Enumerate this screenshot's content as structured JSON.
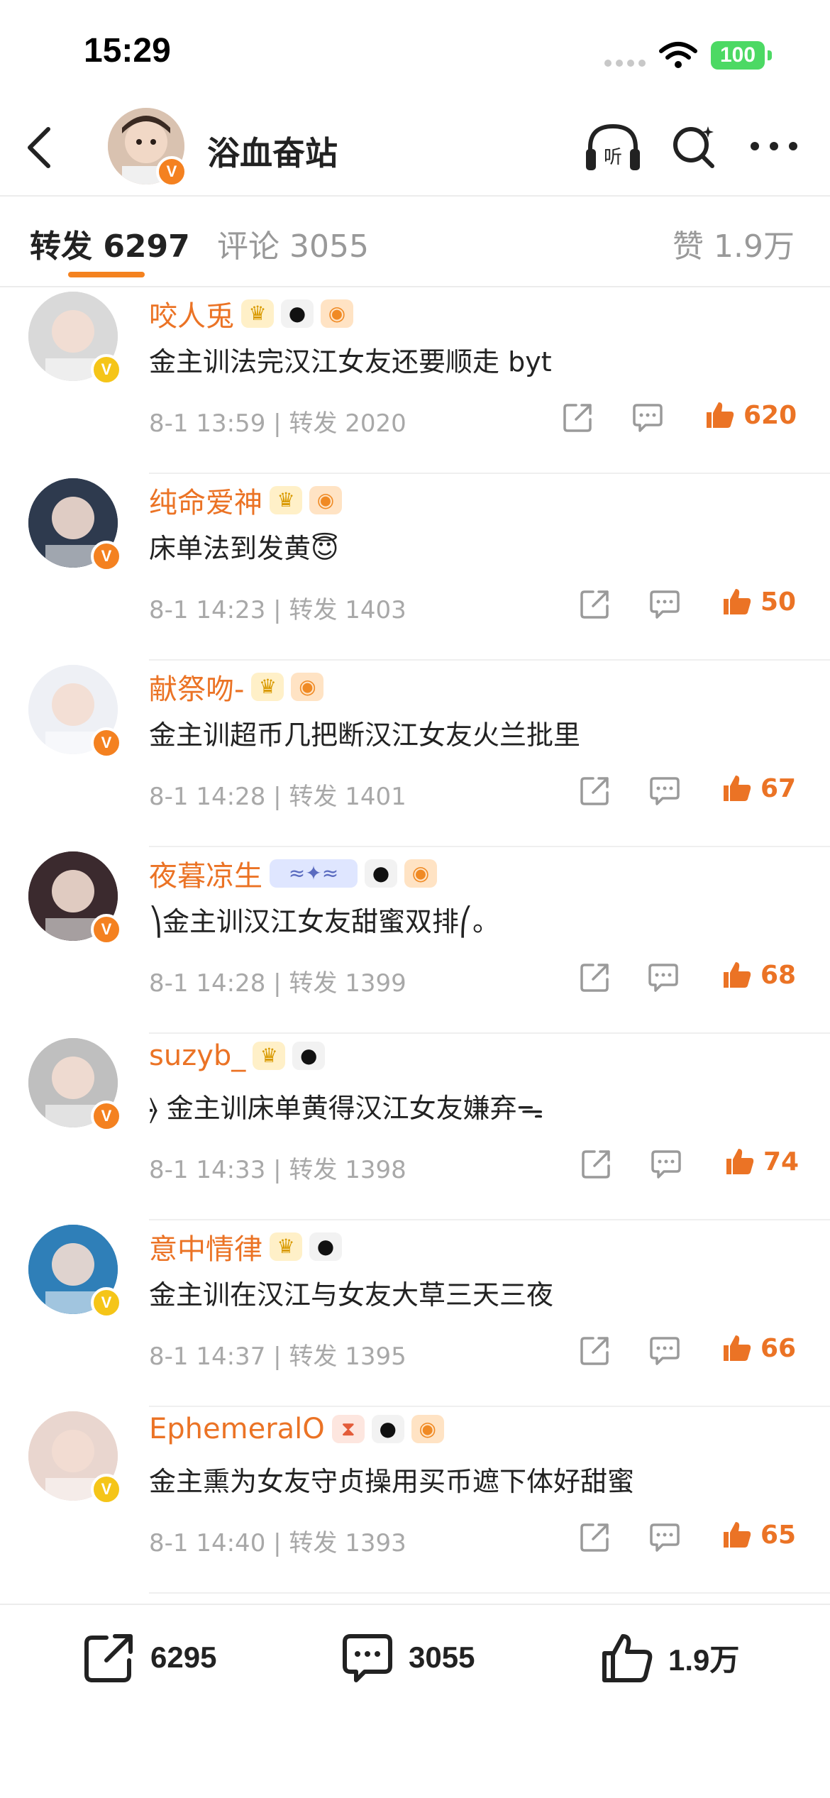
{
  "status_bar": {
    "time": "15:29",
    "battery": "100"
  },
  "header": {
    "title": "浴血奋站",
    "listen_label": "听"
  },
  "tabs": {
    "repost": "转发 6297",
    "comment": "评论 3055",
    "likes": "赞 1.9万"
  },
  "items": [
    {
      "name": "咬人兎",
      "text": "金主训法完汉江女友还要顺走 byt",
      "time": "8-1 13:59",
      "reposts": "转发 2020",
      "likes": "620",
      "badges": [
        "crown",
        "panda",
        "fish"
      ],
      "avatar_color": "#d9d9d9",
      "vbadge": "V",
      "vbadge_color": "gold"
    },
    {
      "name": "纯命爱神",
      "text": "床单法到发黄😇",
      "time": "8-1 14:23",
      "reposts": "转发 1403",
      "likes": "50",
      "badges": [
        "crown",
        "fish"
      ],
      "avatar_color": "#2e3a4e",
      "vbadge": "V",
      "vbadge_color": "orange"
    },
    {
      "name": "献祭吻-",
      "text": "金主训超币几把断汉江女友火兰批里",
      "time": "8-1 14:28",
      "reposts": "转发 1401",
      "likes": "67",
      "badges": [
        "crown",
        "fish"
      ],
      "avatar_color": "#eef0f5",
      "vbadge": "V",
      "vbadge_color": "orange"
    },
    {
      "name": "夜暮凉生",
      "text": "⎞金主训汉江女友甜蜜双排⎛。",
      "time": "8-1 14:28",
      "reposts": "转发 1399",
      "likes": "68",
      "badges": [
        "cat",
        "panda",
        "fish"
      ],
      "avatar_color": "#3b2a2e",
      "vbadge": "V",
      "vbadge_color": "orange"
    },
    {
      "name": "suzyb_",
      "text": "⦒ 金主训床单黄得汉江女友嫌弃ᯓ",
      "time": "8-1 14:33",
      "reposts": "转发 1398",
      "likes": "74",
      "badges": [
        "crown",
        "panda"
      ],
      "avatar_color": "#bfbfbf",
      "vbadge": "V",
      "vbadge_color": "orange"
    },
    {
      "name": "意中情律",
      "text": "金主训在汉江与女友大草三天三夜",
      "time": "8-1 14:37",
      "reposts": "转发 1395",
      "likes": "66",
      "badges": [
        "crown",
        "panda"
      ],
      "avatar_color": "#2f7fb8",
      "vbadge": "V",
      "vbadge_color": "gold"
    },
    {
      "name": "EphemeralO",
      "text": "金主熏为女友守贞操用买币遮下体好甜蜜",
      "time": "8-1 14:40",
      "reposts": "转发 1393",
      "likes": "65",
      "badges": [
        "hour",
        "panda",
        "fish"
      ],
      "avatar_color": "#e9d6cf",
      "vbadge": "V",
      "vbadge_color": "gold"
    }
  ],
  "badge_glyphs": {
    "crown": "♛",
    "panda": "●",
    "fish": "◉",
    "hour": "⧗",
    "cat": "≈✦≈"
  },
  "toolbar": {
    "repost_count": "6295",
    "comment_count": "3055",
    "like_count": "1.9万"
  },
  "colors": {
    "accent": "#eb7325",
    "tab_indicator": "#f4821f",
    "battery": "#4cd964"
  }
}
